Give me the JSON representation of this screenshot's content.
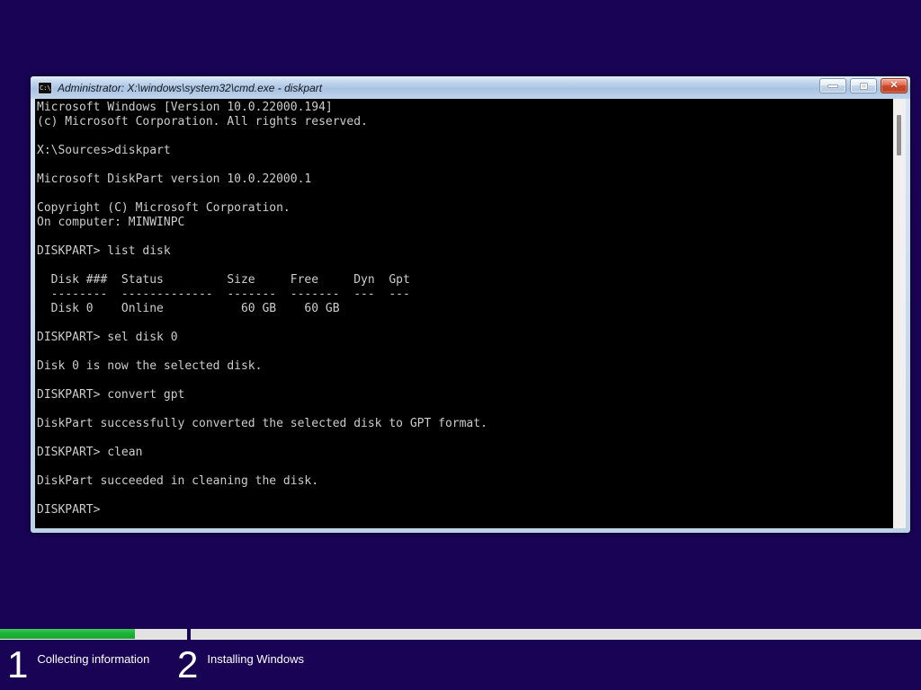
{
  "window": {
    "title": "Administrator: X:\\windows\\system32\\cmd.exe - diskpart",
    "icon": {
      "name": "cmd-prompt-icon",
      "label": "C:\\"
    },
    "controls": {
      "minimize": "minimize",
      "maximize": "maximize",
      "close": "close",
      "close_glyph": "✕"
    }
  },
  "terminal": {
    "prompt": "DISKPART>",
    "lines": [
      "Microsoft Windows [Version 10.0.22000.194]",
      "(c) Microsoft Corporation. All rights reserved.",
      "",
      "X:\\Sources>diskpart",
      "",
      "Microsoft DiskPart version 10.0.22000.1",
      "",
      "Copyright (C) Microsoft Corporation.",
      "On computer: MINWINPC",
      "",
      "DISKPART> list disk",
      "",
      "  Disk ###  Status         Size     Free     Dyn  Gpt",
      "  --------  -------------  -------  -------  ---  ---",
      "  Disk 0    Online           60 GB    60 GB",
      "",
      "DISKPART> sel disk 0",
      "",
      "Disk 0 is now the selected disk.",
      "",
      "DISKPART> convert gpt",
      "",
      "DiskPart successfully converted the selected disk to GPT format.",
      "",
      "DISKPART> clean",
      "",
      "DiskPart succeeded in cleaning the disk.",
      "",
      "DISKPART>"
    ],
    "disk_table": {
      "headers": [
        "Disk ###",
        "Status",
        "Size",
        "Free",
        "Dyn",
        "Gpt"
      ],
      "rows": [
        [
          "Disk 0",
          "Online",
          "60 GB",
          "60 GB",
          "",
          ""
        ]
      ]
    }
  },
  "setup_footer": {
    "steps": [
      {
        "number": "1",
        "label": "Collecting information",
        "progress_percent": 72,
        "state": "in-progress"
      },
      {
        "number": "2",
        "label": "Installing Windows",
        "progress_percent": 0,
        "state": "pending"
      }
    ]
  },
  "colors": {
    "desktop_background": "#190355",
    "terminal_background": "#000000",
    "terminal_text": "#cccccc",
    "titlebar_blue": "#a8c3e2",
    "close_button_red": "#cc4527",
    "progress_fill_green": "#1cb335",
    "progress_track": "#e4e2e0"
  }
}
